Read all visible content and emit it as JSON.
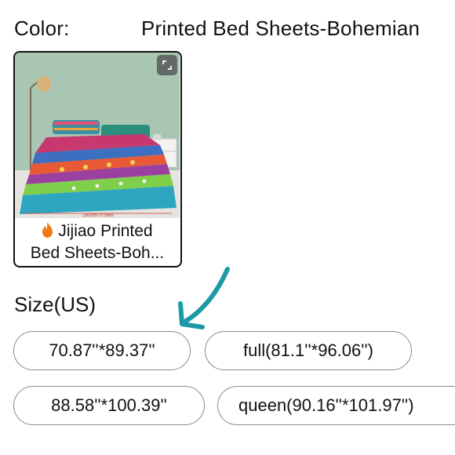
{
  "color": {
    "label": "Color:",
    "value": "Printed Bed Sheets-Bohemian"
  },
  "swatch": {
    "image_icon": "bed-sheet-product-photo",
    "image_dimension_text": "180cm/70.86in",
    "expand_icon": "expand-icon",
    "caption_icon": "flame-icon",
    "caption_line1": "Jijiao Printed",
    "caption_line2": "Bed Sheets-Boh..."
  },
  "size": {
    "label": "Size(US)",
    "options": [
      "70.87''*89.37''",
      "full(81.1''*96.06'')",
      "88.58''*100.39''",
      "queen(90.16''*101.97'')"
    ]
  },
  "annotation": {
    "arrow_icon": "teal-arrow-icon",
    "arrow_color": "#1d9aa6"
  },
  "colors": {
    "flame": "#f07b12",
    "border_selected": "#111111",
    "border_option": "#8a8a8a"
  }
}
